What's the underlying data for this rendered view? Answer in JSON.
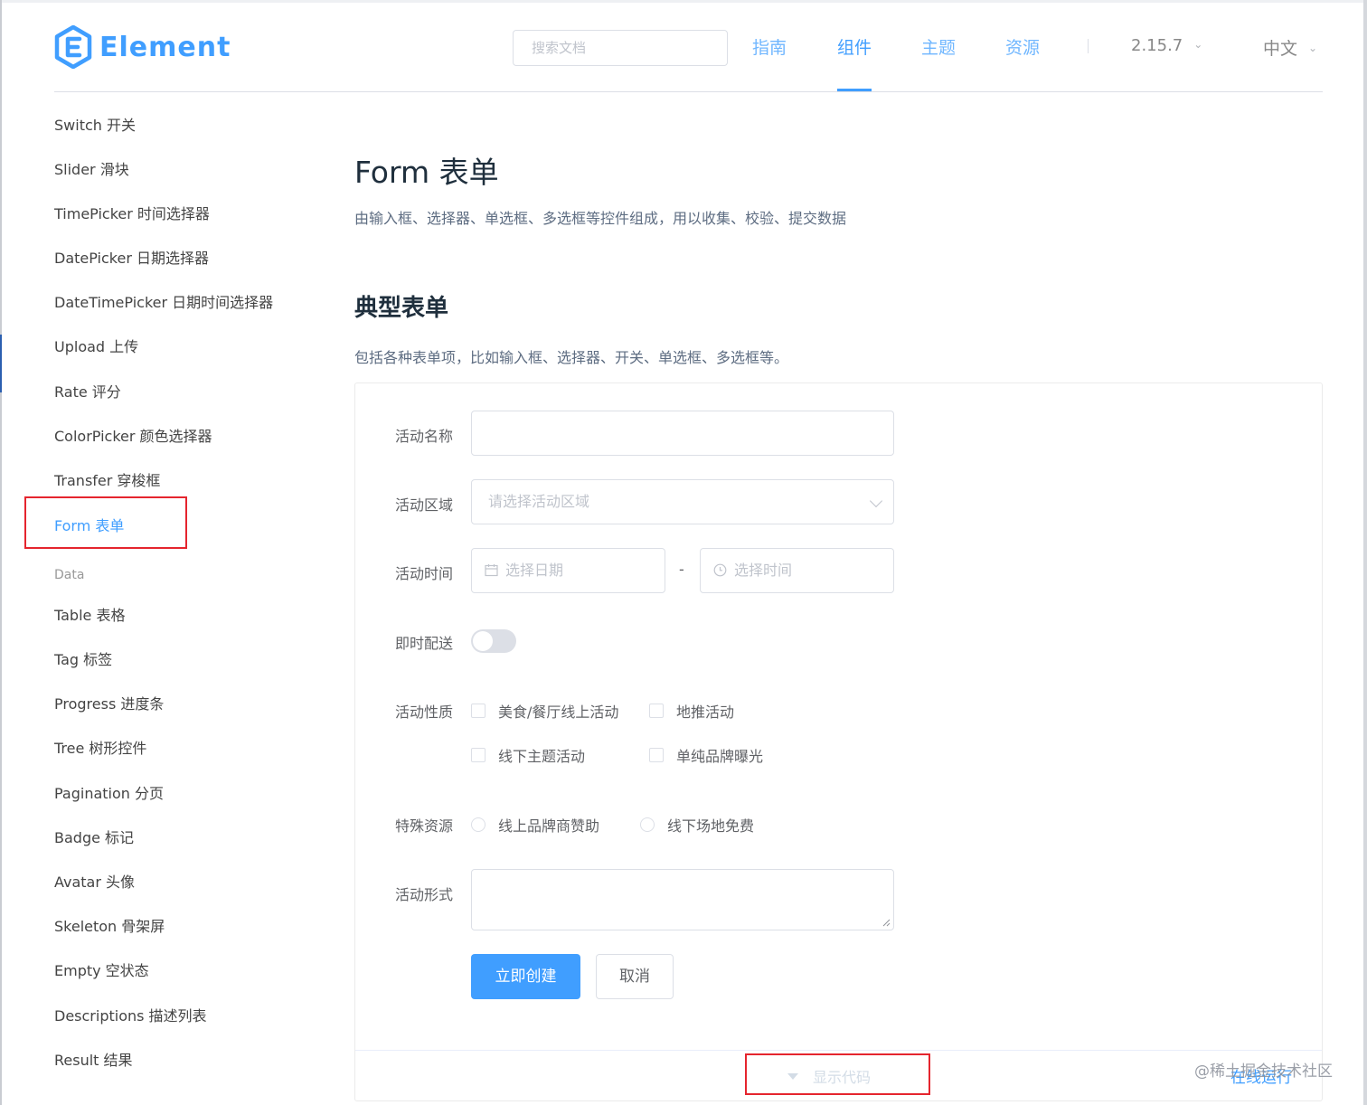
{
  "header": {
    "logo_text": "Element",
    "search_placeholder": "搜索文档",
    "nav": [
      "指南",
      "组件",
      "主题",
      "资源"
    ],
    "active_nav": "组件",
    "version": "2.15.7",
    "language": "中文"
  },
  "sidebar": {
    "items_top": [
      "Switch 开关",
      "Slider 滑块",
      "TimePicker 时间选择器",
      "DatePicker 日期选择器",
      "DateTimePicker 日期时间选择器",
      "Upload 上传",
      "Rate 评分",
      "ColorPicker 颜色选择器",
      "Transfer 穿梭框",
      "Form 表单"
    ],
    "active_item": "Form 表单",
    "group_label": "Data",
    "items_data": [
      "Table 表格",
      "Tag 标签",
      "Progress 进度条",
      "Tree 树形控件",
      "Pagination 分页",
      "Badge 标记",
      "Avatar 头像",
      "Skeleton 骨架屏",
      "Empty 空状态",
      "Descriptions 描述列表",
      "Result 结果"
    ]
  },
  "main": {
    "title": "Form 表单",
    "description": "由输入框、选择器、单选框、多选框等控件组成，用以收集、校验、提交数据",
    "section_title": "典型表单",
    "section_description": "包括各种表单项，比如输入框、选择器、开关、单选框、多选框等。"
  },
  "form": {
    "name_label": "活动名称",
    "name_value": "",
    "region_label": "活动区域",
    "region_placeholder": "请选择活动区域",
    "time_label": "活动时间",
    "date_placeholder": "选择日期",
    "time_separator": "-",
    "time_placeholder": "选择时间",
    "delivery_label": "即时配送",
    "delivery_on": false,
    "type_label": "活动性质",
    "type_options": [
      "美食/餐厅线上活动",
      "地推活动",
      "线下主题活动",
      "单纯品牌曝光"
    ],
    "resource_label": "特殊资源",
    "resource_options": [
      "线上品牌商赞助",
      "线下场地免费"
    ],
    "desc_label": "活动形式",
    "desc_value": "",
    "submit_label": "立即创建",
    "cancel_label": "取消"
  },
  "demo_footer": {
    "show_code": "显示代码",
    "online_run": "在线运行"
  },
  "watermark": "@稀土掘金技术社区",
  "colors": {
    "primary": "#409eff",
    "highlight_box": "#e5252e",
    "text_regular": "#606266",
    "placeholder": "#c0c4cc"
  }
}
